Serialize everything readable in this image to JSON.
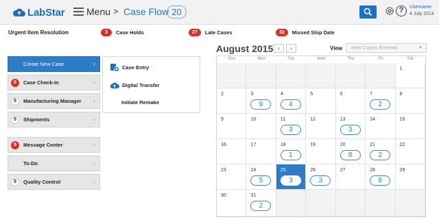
{
  "header": {
    "logo_text": "LabStar",
    "menu_label": "Menu",
    "breadcrumb_arrow": ">",
    "page_title": "Case Flow",
    "case_count": "20",
    "username": "Username",
    "date": "4 July 2014",
    "help_label": "?"
  },
  "urgent": {
    "title": "Urgent Item Resolution",
    "items": [
      {
        "count": "3",
        "label": "Case Holds"
      },
      {
        "count": "27",
        "label": "Late Cases"
      },
      {
        "count": "32",
        "label": "Missed Ship Date"
      }
    ]
  },
  "sidebar": {
    "items": [
      {
        "label": "Create New Case",
        "badge": "",
        "chevron": "›"
      },
      {
        "label": "Case Check-In",
        "badge": "5",
        "chevron": "›"
      },
      {
        "label": "Manufacturing Manager",
        "badge": "5",
        "chevron": "›"
      },
      {
        "label": "Shipments",
        "badge": "5",
        "chevron": "›"
      },
      {
        "label": "Message Center",
        "badge": "5",
        "chevron": "›"
      },
      {
        "label": "To-Do",
        "badge": "",
        "chevron": "›"
      },
      {
        "label": "Quality Control",
        "badge": "5",
        "chevron": "›"
      }
    ]
  },
  "submenu": {
    "items": [
      {
        "label": "Case Entry"
      },
      {
        "label": "Digital Transfer"
      },
      {
        "label": "Initiate Remake"
      }
    ]
  },
  "calendar": {
    "title": "August 2015",
    "prev": "‹",
    "next": "›",
    "view_label": "View",
    "view_placeholder": "New Cases Entered",
    "weekdays": [
      "Sun",
      "Mon",
      "Tue",
      "Wed",
      "Thu",
      "Fri",
      "Sat"
    ],
    "days": [
      "",
      "",
      "",
      "",
      "",
      "",
      "1",
      "2",
      "3",
      "4",
      "5",
      "6",
      "7",
      "8",
      "9",
      "10",
      "11",
      "12",
      "13",
      "14",
      "15",
      "16",
      "17",
      "18",
      "19",
      "20",
      "21",
      "22",
      "23",
      "24",
      "25",
      "26",
      "27",
      "28",
      "29",
      "30",
      "31",
      "",
      "",
      "",
      "",
      ""
    ],
    "counts": {
      "3": "9",
      "4": "4",
      "7": "2",
      "11": "3",
      "13": "3",
      "18": "1",
      "20": "8",
      "21": "2",
      "24": "5",
      "25": "3",
      "26": "3",
      "28": "8",
      "31": "2"
    },
    "today": "25"
  },
  "colors": {
    "accent": "#2e7bc7",
    "alert": "#d9302a"
  }
}
